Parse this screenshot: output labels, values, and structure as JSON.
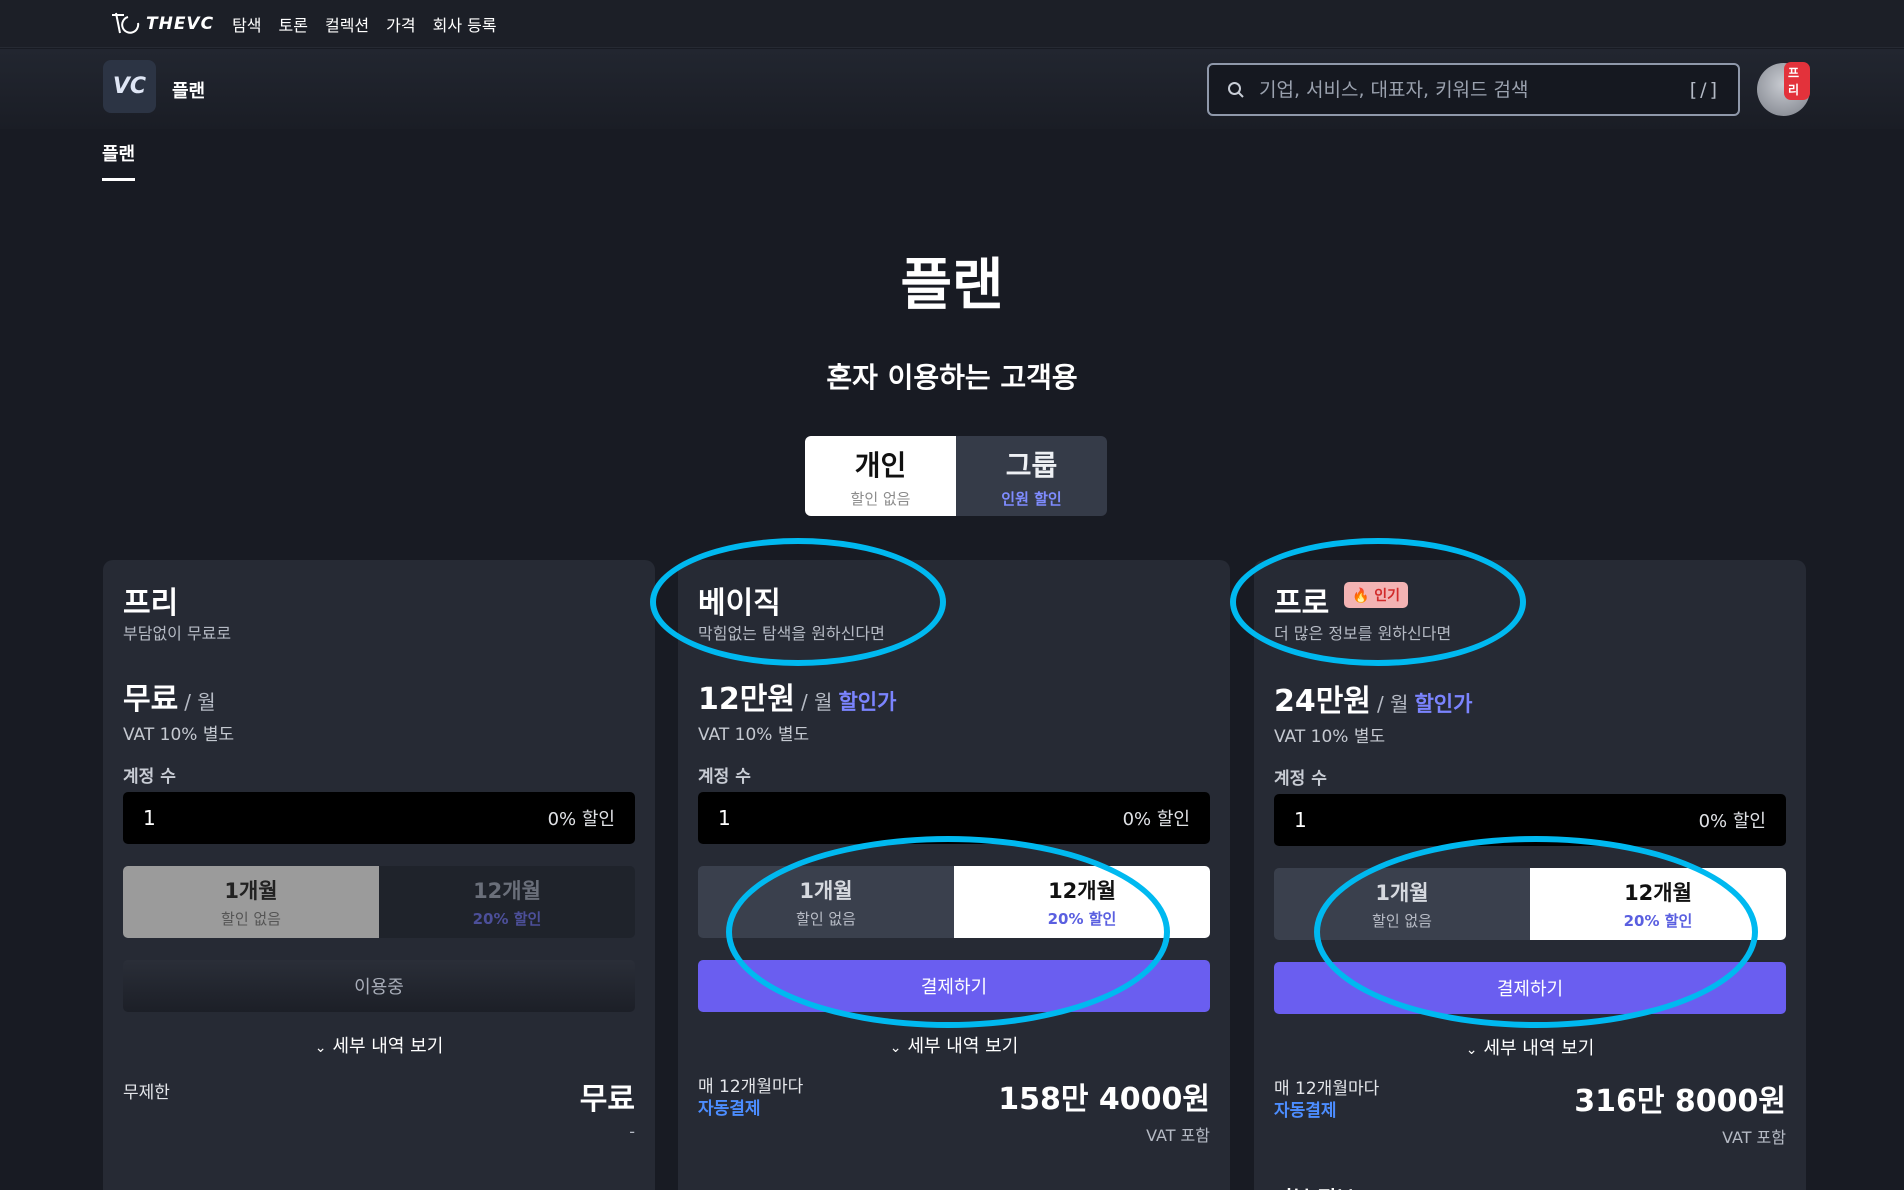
{
  "topnav": {
    "brand": "THEVC",
    "links": [
      "탐색",
      "토론",
      "컬렉션",
      "가격",
      "회사 등록"
    ]
  },
  "subheader": {
    "badge": "VC",
    "title": "플랜",
    "search_placeholder": "기업, 서비스, 대표자, 키워드 검색",
    "search_shortcut": "[/]",
    "avatar_badge": "프리"
  },
  "tabs": {
    "active": "플랜"
  },
  "hero": {
    "title": "플랜",
    "subtitle": "혼자 이용하는 고객용",
    "segments": [
      {
        "label": "개인",
        "sub": "할인 없음"
      },
      {
        "label": "그룹",
        "sub": "인원 할인"
      }
    ]
  },
  "plans": [
    {
      "name": "프리",
      "tagline": "부담없이 무료로",
      "price": "무료",
      "per": "/ 월",
      "discount_label": "",
      "vat": "VAT 10% 별도",
      "accounts_label": "계정 수",
      "accounts_value": "1",
      "accounts_discount": "0% 할인",
      "period_1": {
        "label": "1개월",
        "sub": "할인 없음"
      },
      "period_12": {
        "label": "12개월",
        "sub": "20% 할인"
      },
      "cta": "이용중",
      "details": "세부 내역 보기",
      "billing_left": "무제한",
      "total": "무료",
      "total_note": "-"
    },
    {
      "name": "베이직",
      "tagline": "막힘없는 탐색을 원하신다면",
      "price": "12만원",
      "per": "/ 월",
      "discount_label": "할인가",
      "vat": "VAT 10% 별도",
      "accounts_label": "계정 수",
      "accounts_value": "1",
      "accounts_discount": "0% 할인",
      "period_1": {
        "label": "1개월",
        "sub": "할인 없음"
      },
      "period_12": {
        "label": "12개월",
        "sub": "20% 할인"
      },
      "cta": "결제하기",
      "details": "세부 내역 보기",
      "billing_left": "매 12개월마다",
      "billing_auto": "자동결제",
      "total": "158만 4000원",
      "total_note": "VAT 포함"
    },
    {
      "name": "프로",
      "hot_badge": "🔥 인기",
      "tagline": "더 많은 정보를 원하신다면",
      "price": "24만원",
      "per": "/ 월",
      "discount_label": "할인가",
      "vat": "VAT 10% 별도",
      "accounts_label": "계정 수",
      "accounts_value": "1",
      "accounts_discount": "0% 할인",
      "period_1": {
        "label": "1개월",
        "sub": "할인 없음"
      },
      "period_12": {
        "label": "12개월",
        "sub": "20% 할인"
      },
      "cta": "결제하기",
      "details": "세부 내역 보기",
      "billing_left": "매 12개월마다",
      "billing_auto": "자동결제",
      "total": "316만 8000원",
      "total_note": "VAT 포함",
      "next_section": "기본 정보"
    }
  ],
  "colors": {
    "background": "#181b23",
    "card": "#262a34",
    "accent": "#6a5ef0",
    "discount_text": "#7b84ff",
    "auto_pay": "#4c8dff",
    "annotation_ring": "#00b9f0"
  }
}
